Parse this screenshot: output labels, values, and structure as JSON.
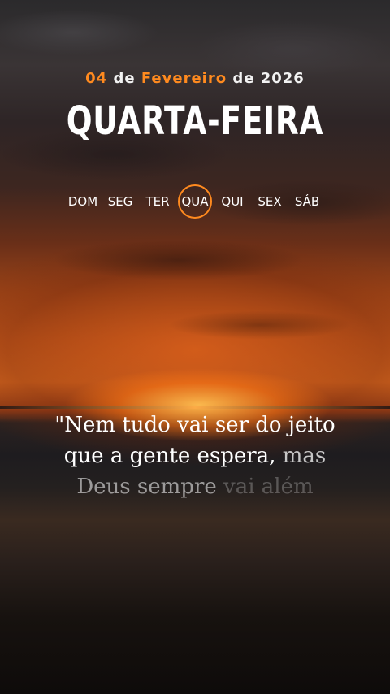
{
  "header": {
    "day_number": "04",
    "de1": "de",
    "month": "Fevereiro",
    "de2": "de",
    "year": "2026",
    "weekday": "QUARTA-FEIRA"
  },
  "week": {
    "days": [
      {
        "label": "DOM",
        "selected": false
      },
      {
        "label": "SEG",
        "selected": false
      },
      {
        "label": "TER",
        "selected": false
      },
      {
        "label": "QUA",
        "selected": true
      },
      {
        "label": "QUI",
        "selected": false
      },
      {
        "label": "SEX",
        "selected": false
      },
      {
        "label": "SÁB",
        "selected": false
      }
    ]
  },
  "quote": {
    "line1": "\"Nem tudo vai ser do jeito",
    "line2a": "que a gente espera,",
    "line2b": "mas",
    "line3a": "Deus sempre",
    "line3b": "vai além"
  },
  "colors": {
    "accent": "#ff8a1f",
    "text": "#ffffff"
  }
}
